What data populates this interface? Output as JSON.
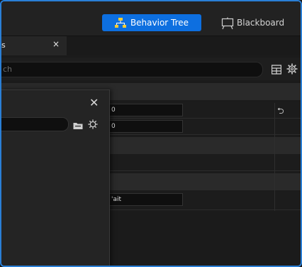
{
  "toolbar": {
    "modes": [
      {
        "label": "Behavior Tree",
        "icon": "tree-hierarchy-icon",
        "active": true
      },
      {
        "label": "Blackboard",
        "icon": "blackboard-icon",
        "active": false
      }
    ]
  },
  "tabs": [
    {
      "label": "s",
      "close": "×"
    }
  ],
  "search": {
    "placeholder": "ch"
  },
  "details": {
    "rows": [
      {
        "value": "0"
      },
      {
        "value": "0"
      },
      {
        "value": "'ait"
      }
    ],
    "reset_icon": "⮌"
  },
  "panel": {
    "close": "✕"
  },
  "colors": {
    "accent": "#0d6fe0",
    "background": "#1b1b1b",
    "panel": "#242424"
  }
}
